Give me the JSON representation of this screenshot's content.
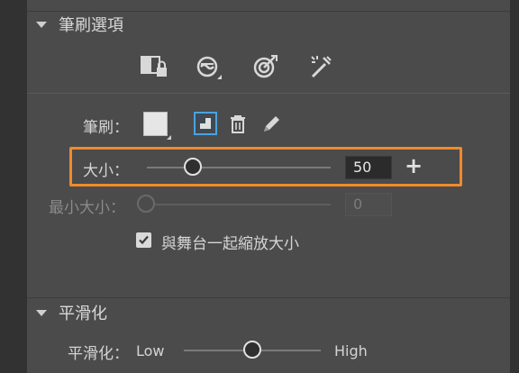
{
  "brush_options": {
    "title": "筆刷選項",
    "brush_label": "筆刷：",
    "size_label": "大小：",
    "size_value": "50",
    "min_size_label": "最小大小：",
    "min_size_value": "0",
    "scale_checkbox_label": "與舞台一起縮放大小",
    "scale_checked": true,
    "size_slider_fraction": 0.25,
    "min_size_slider_fraction": 0.0
  },
  "smoothing": {
    "title": "平滑化",
    "label": "平滑化：",
    "low": "Low",
    "high": "High",
    "slider_fraction": 0.5
  },
  "icons": [
    "lock-fill-icon",
    "pressure-icon",
    "target-icon",
    "magic-wand-icon",
    "trash-icon",
    "pencil-icon",
    "plus-icon"
  ],
  "colors": {
    "accent_highlight": "#f08a2c",
    "selected_border": "#4aa3df"
  }
}
